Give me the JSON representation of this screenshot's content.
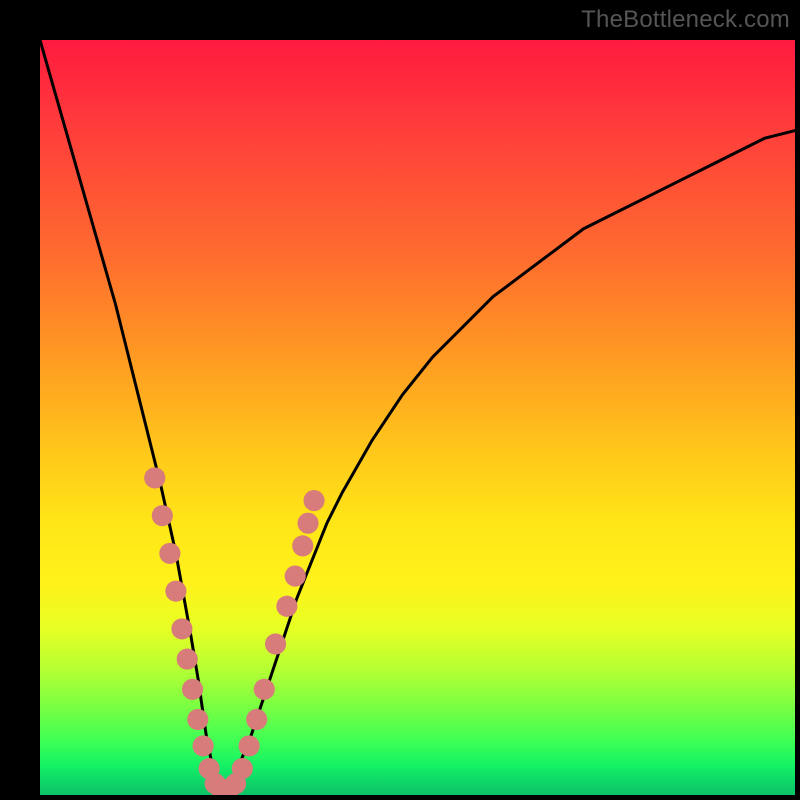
{
  "watermark": "TheBottleneck.com",
  "chart_data": {
    "type": "line",
    "title": "",
    "xlabel": "",
    "ylabel": "",
    "xlim": [
      0,
      100
    ],
    "ylim": [
      0,
      100
    ],
    "curve": {
      "x": [
        0,
        2,
        4,
        6,
        8,
        10,
        12,
        14,
        16,
        18,
        20,
        21,
        22,
        23,
        24,
        25,
        26,
        28,
        30,
        32,
        34,
        36,
        38,
        40,
        44,
        48,
        52,
        56,
        60,
        64,
        68,
        72,
        76,
        80,
        84,
        88,
        92,
        96,
        100
      ],
      "y": [
        100,
        93,
        86,
        79,
        72,
        65,
        57,
        49,
        41,
        32,
        21,
        15,
        8,
        3,
        1,
        1,
        3,
        8,
        14,
        20,
        26,
        31,
        36,
        40,
        47,
        53,
        58,
        62,
        66,
        69,
        72,
        75,
        77,
        79,
        81,
        83,
        85,
        87,
        88
      ]
    },
    "dots": {
      "color": "#d87b7b",
      "radius_pct": 1.4,
      "points": [
        {
          "x": 15.2,
          "y": 42
        },
        {
          "x": 16.2,
          "y": 37
        },
        {
          "x": 17.2,
          "y": 32
        },
        {
          "x": 18.0,
          "y": 27
        },
        {
          "x": 18.8,
          "y": 22
        },
        {
          "x": 19.5,
          "y": 18
        },
        {
          "x": 20.2,
          "y": 14
        },
        {
          "x": 20.9,
          "y": 10
        },
        {
          "x": 21.6,
          "y": 6.5
        },
        {
          "x": 22.4,
          "y": 3.5
        },
        {
          "x": 23.2,
          "y": 1.5
        },
        {
          "x": 24.0,
          "y": 0.8
        },
        {
          "x": 25.0,
          "y": 0.8
        },
        {
          "x": 25.9,
          "y": 1.5
        },
        {
          "x": 26.8,
          "y": 3.5
        },
        {
          "x": 27.7,
          "y": 6.5
        },
        {
          "x": 28.7,
          "y": 10
        },
        {
          "x": 29.7,
          "y": 14
        },
        {
          "x": 31.2,
          "y": 20
        },
        {
          "x": 32.7,
          "y": 25
        },
        {
          "x": 33.8,
          "y": 29
        },
        {
          "x": 34.8,
          "y": 33
        },
        {
          "x": 35.5,
          "y": 36
        },
        {
          "x": 36.3,
          "y": 39
        }
      ]
    }
  }
}
